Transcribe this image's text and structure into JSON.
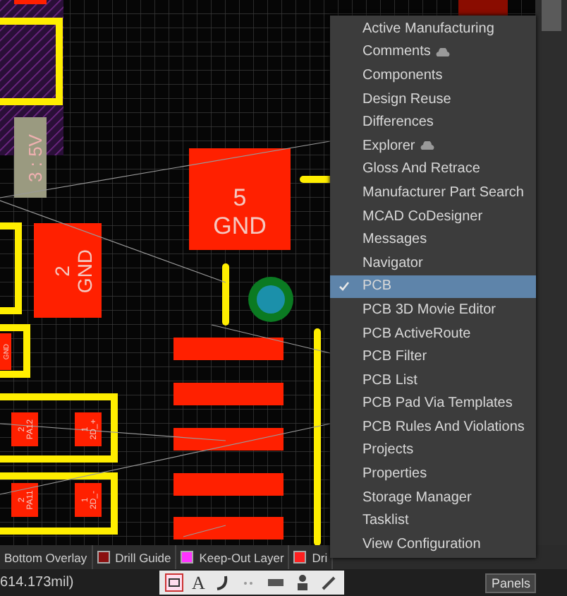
{
  "canvas": {
    "pad_labels": [
      {
        "kind": "rot",
        "text": "3 : 5V"
      },
      {
        "kind": "flat",
        "text": "5"
      },
      {
        "kind": "flat",
        "text": "GND"
      },
      {
        "kind": "rot",
        "text": "2"
      },
      {
        "kind": "rot",
        "text": "GND"
      },
      {
        "kind": "rot",
        "text": "GND"
      },
      {
        "kind": "rot",
        "text": "2"
      },
      {
        "kind": "rot",
        "text": "PA12"
      },
      {
        "kind": "rot",
        "text": "1"
      },
      {
        "kind": "rot",
        "text": "2D_+"
      },
      {
        "kind": "rot",
        "text": "2"
      },
      {
        "kind": "rot",
        "text": "PA11"
      },
      {
        "kind": "rot",
        "text": "1"
      },
      {
        "kind": "rot",
        "text": "2D_-"
      }
    ]
  },
  "menu": {
    "items": [
      {
        "label": "Active Manufacturing",
        "cloud": false,
        "checked": false,
        "selected": false
      },
      {
        "label": "Comments",
        "cloud": true,
        "checked": false,
        "selected": false
      },
      {
        "label": "Components",
        "cloud": false,
        "checked": false,
        "selected": false
      },
      {
        "label": "Design Reuse",
        "cloud": false,
        "checked": false,
        "selected": false
      },
      {
        "label": "Differences",
        "cloud": false,
        "checked": false,
        "selected": false
      },
      {
        "label": "Explorer",
        "cloud": true,
        "checked": false,
        "selected": false
      },
      {
        "label": "Gloss And Retrace",
        "cloud": false,
        "checked": false,
        "selected": false
      },
      {
        "label": "Manufacturer Part Search",
        "cloud": false,
        "checked": false,
        "selected": false
      },
      {
        "label": "MCAD CoDesigner",
        "cloud": false,
        "checked": false,
        "selected": false
      },
      {
        "label": "Messages",
        "cloud": false,
        "checked": false,
        "selected": false
      },
      {
        "label": "Navigator",
        "cloud": false,
        "checked": false,
        "selected": false
      },
      {
        "label": "PCB",
        "cloud": false,
        "checked": true,
        "selected": true
      },
      {
        "label": "PCB 3D Movie Editor",
        "cloud": false,
        "checked": false,
        "selected": false
      },
      {
        "label": "PCB ActiveRoute",
        "cloud": false,
        "checked": false,
        "selected": false
      },
      {
        "label": "PCB Filter",
        "cloud": false,
        "checked": false,
        "selected": false
      },
      {
        "label": "PCB List",
        "cloud": false,
        "checked": false,
        "selected": false
      },
      {
        "label": "PCB Pad Via Templates",
        "cloud": false,
        "checked": false,
        "selected": false
      },
      {
        "label": "PCB Rules And Violations",
        "cloud": false,
        "checked": false,
        "selected": false
      },
      {
        "label": "Projects",
        "cloud": false,
        "checked": false,
        "selected": false
      },
      {
        "label": "Properties",
        "cloud": false,
        "checked": false,
        "selected": false
      },
      {
        "label": "Storage Manager",
        "cloud": false,
        "checked": false,
        "selected": false
      },
      {
        "label": "Tasklist",
        "cloud": false,
        "checked": false,
        "selected": false
      },
      {
        "label": "View Configuration",
        "cloud": false,
        "checked": false,
        "selected": false
      }
    ]
  },
  "layer_tabs": [
    {
      "name": "Bottom Overlay"
    },
    {
      "name": "Drill Guide",
      "color": "#8b1010"
    },
    {
      "name": "Keep-Out Layer",
      "color": "#ff33ff"
    },
    {
      "name": "Dri",
      "color": "#ff2020"
    }
  ],
  "status_bar": {
    "coordinates": "614.173mil)",
    "text_tool_glyph": "A",
    "panels_button": "Panels"
  }
}
